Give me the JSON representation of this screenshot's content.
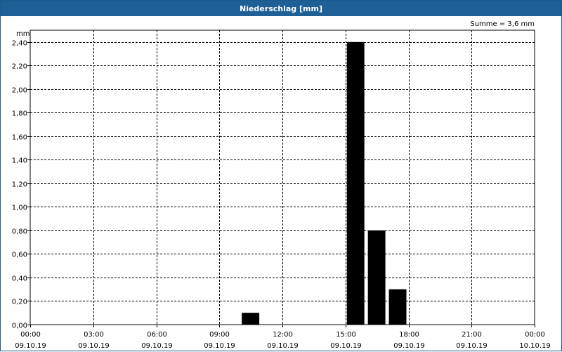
{
  "window": {
    "title": "Niederschlag [mm]"
  },
  "chart_data": {
    "type": "bar",
    "title": "Niederschlag [mm]",
    "ylabel": "mm",
    "annotation": "Summe = 3,6 mm",
    "ylim": [
      0,
      2.5
    ],
    "yticks": [
      "0,00",
      "0,20",
      "0,40",
      "0,60",
      "0,80",
      "1,00",
      "1,20",
      "1,40",
      "1,60",
      "1,80",
      "2,00",
      "2,20",
      "2,40"
    ],
    "xlim_hours": [
      0,
      24
    ],
    "xticks": [
      {
        "time": "00:00",
        "date": "09.10.19"
      },
      {
        "time": "03:00",
        "date": "09.10.19"
      },
      {
        "time": "06:00",
        "date": "09.10.19"
      },
      {
        "time": "09:00",
        "date": "09.10.19"
      },
      {
        "time": "12:00",
        "date": "09.10.19"
      },
      {
        "time": "15:00",
        "date": "09.10.19"
      },
      {
        "time": "18:00",
        "date": "09.10.19"
      },
      {
        "time": "21:00",
        "date": "09.10.19"
      },
      {
        "time": "00:00",
        "date": "10.10.19"
      }
    ],
    "bars": [
      {
        "start": "10:00",
        "end": "11:00",
        "value": 0.1
      },
      {
        "start": "15:00",
        "end": "16:00",
        "value": 2.4
      },
      {
        "start": "16:00",
        "end": "17:00",
        "value": 0.8
      },
      {
        "start": "17:00",
        "end": "18:00",
        "value": 0.3
      }
    ],
    "grid": true,
    "bar_color": "#000000"
  }
}
